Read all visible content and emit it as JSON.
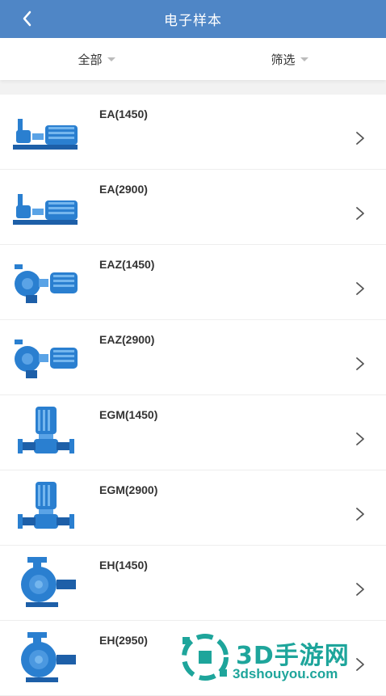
{
  "header": {
    "title": "电子样本"
  },
  "filters": {
    "all": "全部",
    "filter": "筛选"
  },
  "items": [
    {
      "name": "EA(1450)",
      "icon": "horizontal-pump-icon"
    },
    {
      "name": "EA(2900)",
      "icon": "horizontal-pump-icon"
    },
    {
      "name": "EAZ(1450)",
      "icon": "end-suction-pump-icon"
    },
    {
      "name": "EAZ(2900)",
      "icon": "end-suction-pump-icon"
    },
    {
      "name": "EGM(1450)",
      "icon": "vertical-inline-pump-icon"
    },
    {
      "name": "EGM(2900)",
      "icon": "vertical-inline-pump-icon"
    },
    {
      "name": "EH(1450)",
      "icon": "volute-pump-icon"
    },
    {
      "name": "EH(2950)",
      "icon": "volute-pump-icon"
    }
  ],
  "watermark": {
    "brand": "3D手游网",
    "url": "3dshouyou.com"
  },
  "colors": {
    "header": "#4f86c6",
    "pump": "#2a7fd0",
    "watermark": "#1ea59b"
  }
}
